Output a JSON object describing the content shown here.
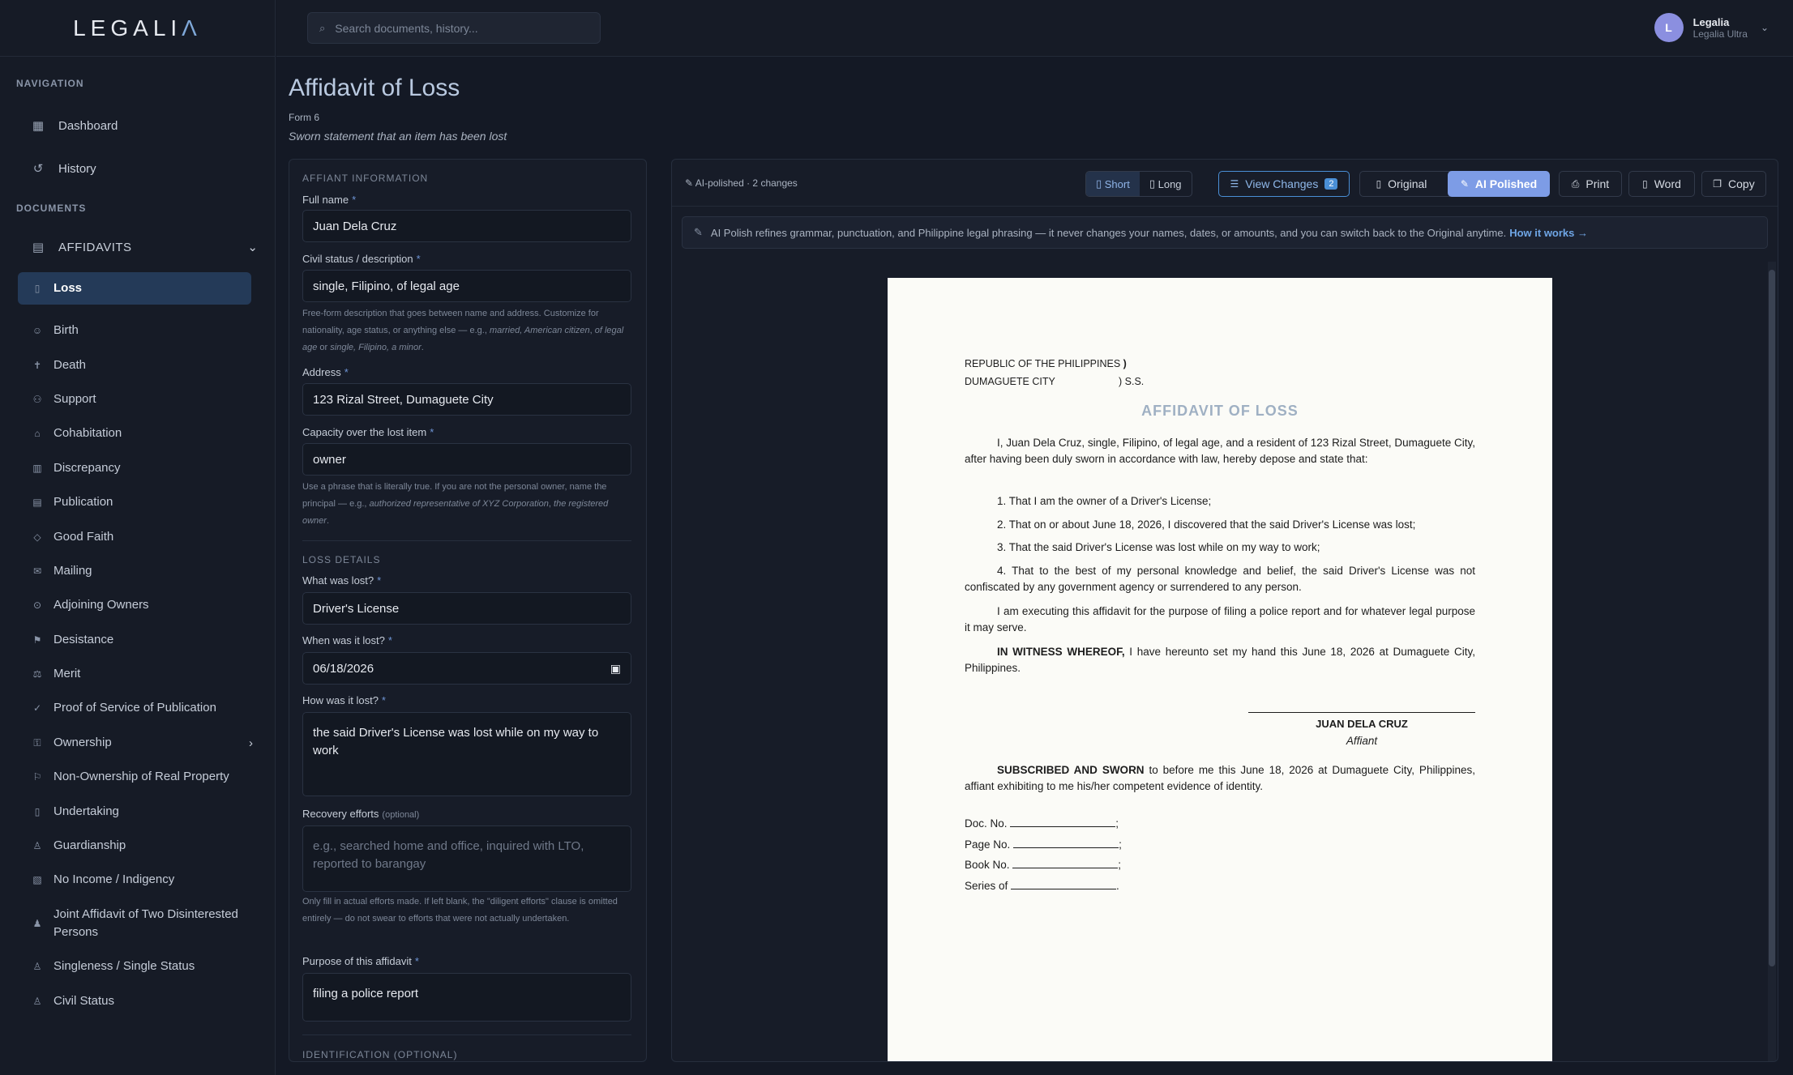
{
  "brand": {
    "left": "LEGALI",
    "mark": "Λ"
  },
  "search": {
    "placeholder": "Search documents, history..."
  },
  "user": {
    "initial": "L",
    "name": "Legalia",
    "plan": "Legalia Ultra"
  },
  "nav": {
    "navigation_header": "NAVIGATION",
    "dashboard": "Dashboard",
    "history": "History",
    "documents_header": "DOCUMENTS",
    "affidavits": "AFFIDAVITS",
    "items": [
      "Loss",
      "Birth",
      "Death",
      "Support",
      "Cohabitation",
      "Discrepancy",
      "Publication",
      "Good Faith",
      "Mailing",
      "Adjoining Owners",
      "Desistance",
      "Merit",
      "Proof of Service of Publication",
      "Ownership",
      "Non-Ownership of Real Property",
      "Undertaking",
      "Guardianship",
      "No Income / Indigency",
      "Joint Affidavit of Two Disinterested Persons",
      "Singleness / Single Status",
      "Civil Status"
    ]
  },
  "page": {
    "title": "Affidavit of Loss",
    "form_no": "Form 6",
    "subtitle": "Sworn statement that an item has been lost"
  },
  "form": {
    "sec_affiant": "AFFIANT INFORMATION",
    "full_name_label": "Full name",
    "full_name": "Juan Dela Cruz",
    "civil_label": "Civil status / description",
    "civil": "single, Filipino, of legal age",
    "civil_help_a": "Free-form description that goes between name and address. Customize for nationality, age status, or anything else — e.g., ",
    "civil_help_b": "married, American citizen",
    "civil_help_c": ", ",
    "civil_help_d": "of legal age",
    "civil_help_e": " or ",
    "civil_help_f": "single, Filipino, a minor",
    "address_label": "Address",
    "address": "123 Rizal Street, Dumaguete City",
    "capacity_label": "Capacity over the lost item",
    "capacity": "owner",
    "capacity_help_a": "Use a phrase that is literally true. If you are not the personal owner, name the principal — e.g., ",
    "capacity_help_b": "authorized representative of XYZ Corporation",
    "capacity_help_c": ", ",
    "capacity_help_d": "the registered owner",
    "sec_loss": "LOSS DETAILS",
    "what_label": "What was lost?",
    "what": "Driver's License",
    "when_label": "When was it lost?",
    "when": "06/18/2026",
    "how_label": "How was it lost?",
    "how": "the said Driver's License was lost while on my way to work",
    "recovery_label": "Recovery efforts",
    "optional": "(optional)",
    "recovery_ph": "e.g., searched home and office, inquired with LTO, reported to barangay",
    "recovery_help": "Only fill in actual efforts made. If left blank, the \"diligent efforts\" clause is omitted entirely — do not swear to efforts that were not actually undertaken.",
    "purpose_label": "Purpose of this affidavit",
    "purpose": "filing a police report",
    "sec_id": "IDENTIFICATION (OPTIONAL)"
  },
  "preview": {
    "status": "AI-polished · 2 changes",
    "short": "Short",
    "long": "Long",
    "view_changes": "View Changes",
    "changes_count": "2",
    "original": "Original",
    "ai_polished": "AI Polished",
    "print": "Print",
    "word": "Word",
    "copy": "Copy",
    "notice": "AI Polish refines grammar, punctuation, and Philippine legal phrasing — it never changes your names, dates, or amounts, and you can switch back to the Original anytime.",
    "notice_link": "How it works →"
  },
  "doc": {
    "republic": "REPUBLIC OF THE PHILIPPINES",
    ")": ")",
    "city": "DUMAGUETE CITY",
    "ss": ") S.S.",
    "title": "AFFIDAVIT OF LOSS",
    "intro": "I, Juan Dela Cruz, single, Filipino, of legal age, and a resident of 123 Rizal Street, Dumaguete City, after having been duly sworn in accordance with law, hereby depose and state that:",
    "p1": "1. That I am the owner of a Driver's License;",
    "p2": "2. That on or about June 18, 2026, I discovered that the said Driver's License was lost;",
    "p3": "3. That the said Driver's License was lost while on my way to work;",
    "p4": "4. That to the best of my personal knowledge and belief, the said Driver's License was not confiscated by any government agency or surrendered to any person.",
    "p5": "I am executing this affidavit for the purpose of filing a police report and for whatever legal purpose it may serve.",
    "witness_b": "IN WITNESS WHEREOF,",
    "witness": " I have hereunto set my hand this June 18, 2026 at Dumaguete City, Philippines.",
    "affiant_name": "JUAN DELA CRUZ",
    "affiant": "Affiant",
    "sub_b": "SUBSCRIBED AND SWORN",
    "sub": " to before me this June 18, 2026 at Dumaguete City, Philippines, affiant exhibiting to me his/her competent evidence of identity.",
    "doc_no": "Doc. No.",
    "page_no": "Page No.",
    "book_no": "Book No.",
    "series": "Series of",
    "semi": ";",
    "dot": "."
  }
}
